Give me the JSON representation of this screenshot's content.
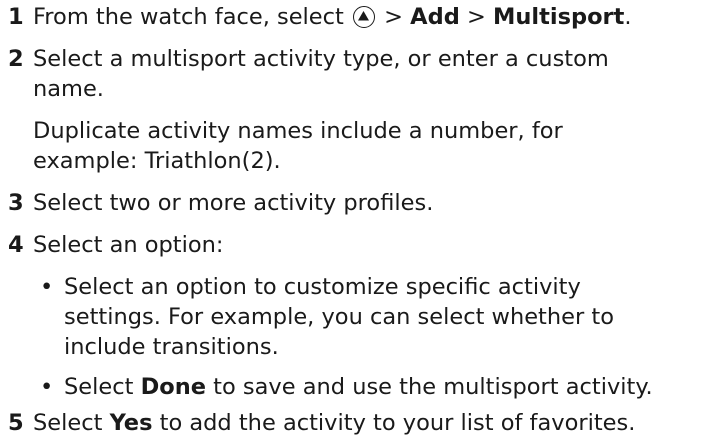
{
  "steps": [
    {
      "number": "1",
      "text_a": "From the watch face, select ",
      "icon": "up-arrow-button-icon",
      "text_b": " > ",
      "bold_1": "Add",
      "text_c": " > ",
      "bold_2": "Multisport",
      "text_d": "."
    },
    {
      "number": "2",
      "text": "Select a multisport activity type, or enter a custom",
      "text_line2": "name.",
      "note_line1": "Duplicate activity names include a number, for",
      "note_line2": "example: Triathlon(2)."
    },
    {
      "number": "3",
      "text": "Select two or more activity profiles."
    },
    {
      "number": "4",
      "text": "Select an option:",
      "options": [
        {
          "line1": "Select an option to customize specific activity",
          "line2": "settings. For example, you can select whether to",
          "line3": "include transitions."
        },
        {
          "text_a": "Select ",
          "bold": "Done",
          "text_b": " to save and use the multisport activity."
        }
      ]
    },
    {
      "number": "5",
      "text_a": "Select ",
      "bold": "Yes",
      "text_b": " to add the activity to your list of favorites."
    }
  ],
  "bullet_char": "•"
}
